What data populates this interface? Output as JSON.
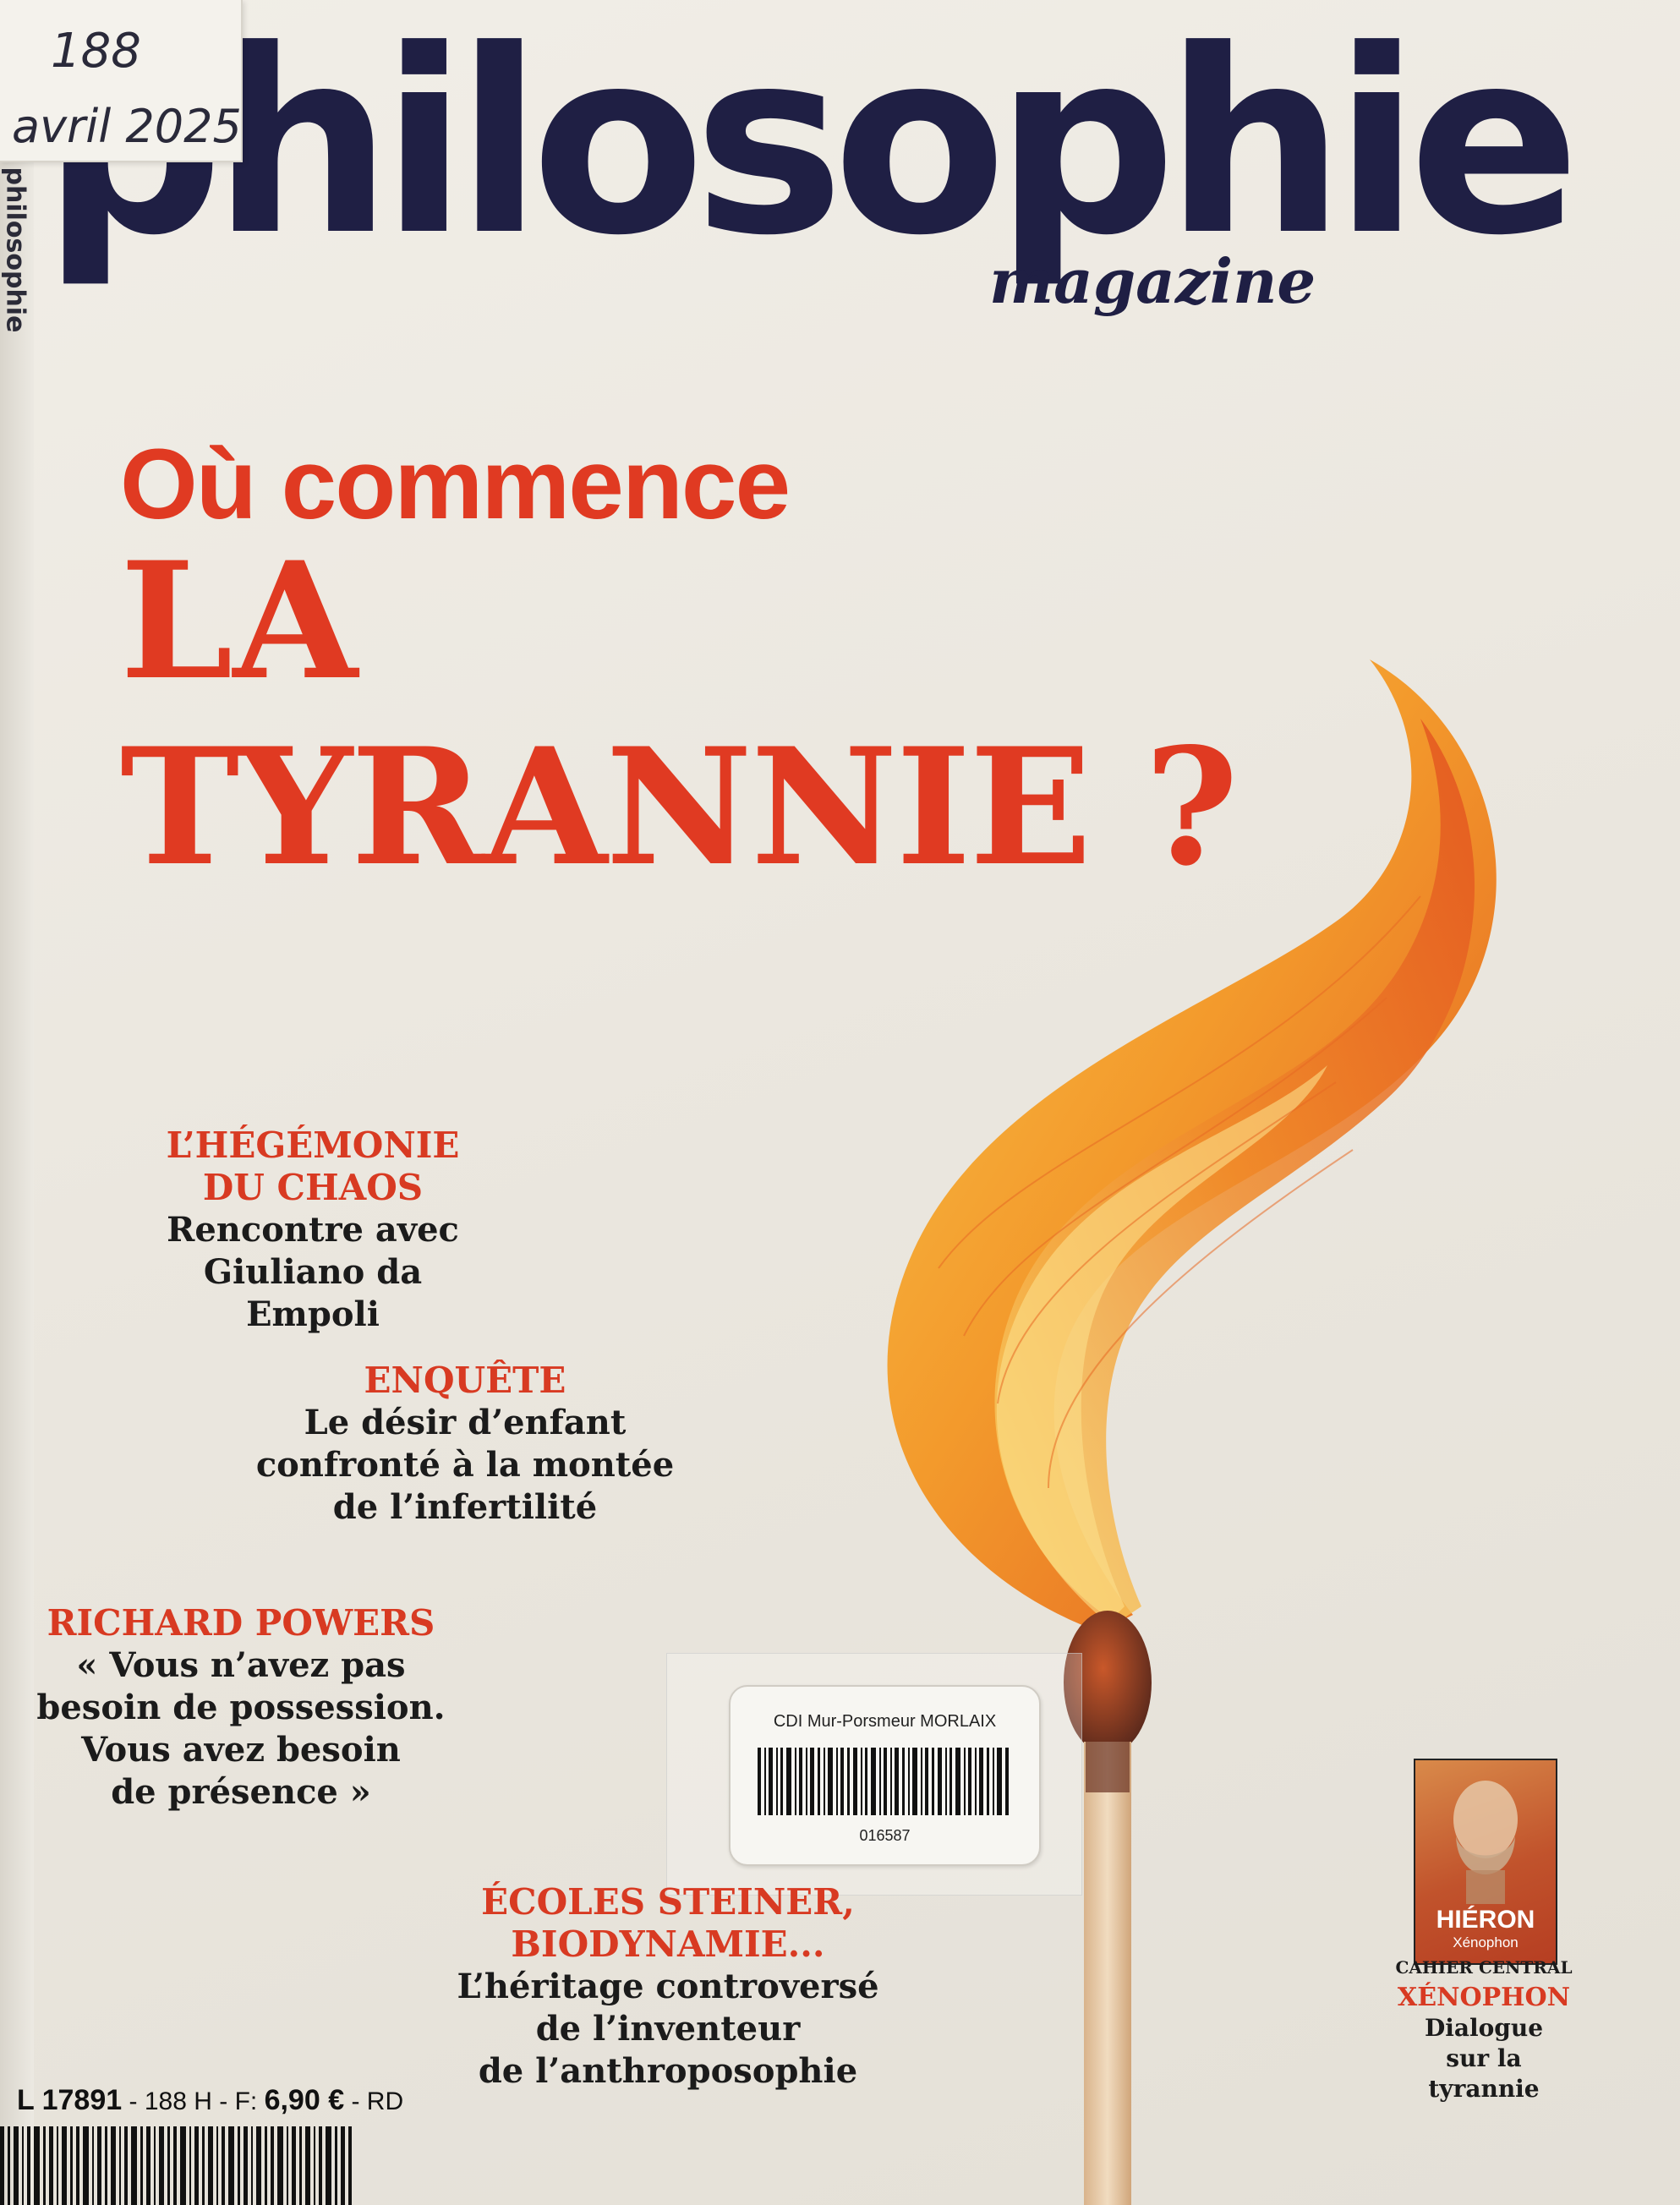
{
  "handwriting": {
    "issue_number": "188",
    "date": "avril 2025"
  },
  "spine": {
    "title": "philosophie"
  },
  "masthead": {
    "title": "philosophie",
    "subtitle": "magazine"
  },
  "headline": {
    "line1": "Où commence",
    "line2": "LA",
    "line3": "TYRANNIE ?"
  },
  "stories": [
    {
      "kicker": [
        "L’HÉGÉMONIE",
        "DU CHAOS"
      ],
      "deck": [
        "Rencontre avec",
        "Giuliano da Empoli"
      ]
    },
    {
      "kicker": [
        "ENQUÊTE"
      ],
      "deck": [
        "Le désir d’enfant",
        "confronté à la montée",
        "de l’infertilité"
      ]
    },
    {
      "kicker": [
        "RICHARD POWERS"
      ],
      "deck": [
        "« Vous n’avez pas",
        "besoin de possession.",
        "Vous avez besoin",
        "de présence »"
      ]
    },
    {
      "kicker": [
        "ÉCOLES STEINER,",
        "BIODYNAMIE..."
      ],
      "deck": [
        "L’héritage controversé",
        "de l’inventeur",
        "de l’anthroposophie"
      ]
    }
  ],
  "supplement": {
    "cover_title": "HIÉRON",
    "cover_author": "Xénophon",
    "label": "CAHIER CENTRAL",
    "kicker": "XÉNOPHON",
    "deck": [
      "Dialogue",
      "sur la tyrannie"
    ]
  },
  "library_label": {
    "title": "CDI Mur-Porsmeur MORLAIX",
    "code": "016587"
  },
  "price": {
    "code": "L 17891",
    "issue": "188 H",
    "prefix": "F:",
    "amount": "6,90 €",
    "suffix": "RD"
  },
  "colors": {
    "accent": "#e03a22",
    "masthead": "#1f1f44",
    "background": "#ede9e1"
  }
}
